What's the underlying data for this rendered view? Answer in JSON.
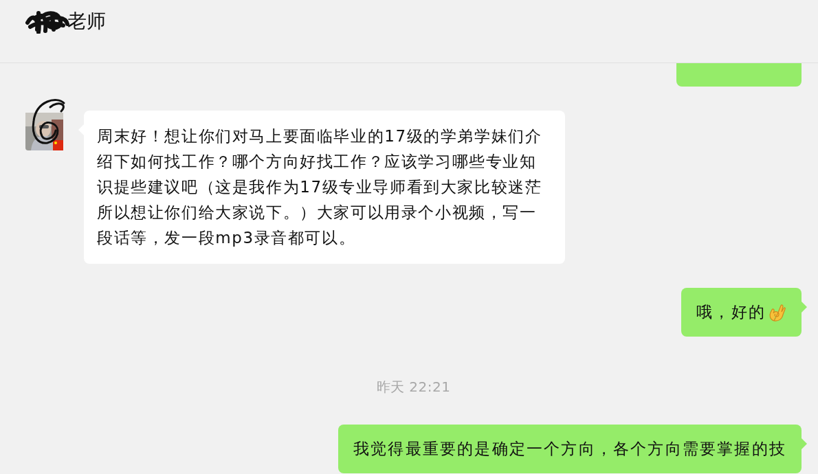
{
  "header": {
    "title": "老师"
  },
  "messages": [
    {
      "kind": "partial"
    },
    {
      "kind": "incoming",
      "text": "周末好！想让你们对马上要面临毕业的17级的学弟学妹们介绍下如何找工作？哪个方向好找工作？应该学习哪些专业知识提些建议吧（这是我作为17级专业导师看到大家比较迷茫所以想让你们给大家说下。）大家可以用录个小视频，写一段话等，发一段mp3录音都可以。"
    },
    {
      "kind": "outgoing",
      "text": "哦，好的",
      "emoji": true
    },
    {
      "kind": "time",
      "text": "昨天 22:21"
    },
    {
      "kind": "outgoing",
      "text": "我觉得最重要的是确定一个方向，各个方向需要掌握的技"
    }
  ]
}
